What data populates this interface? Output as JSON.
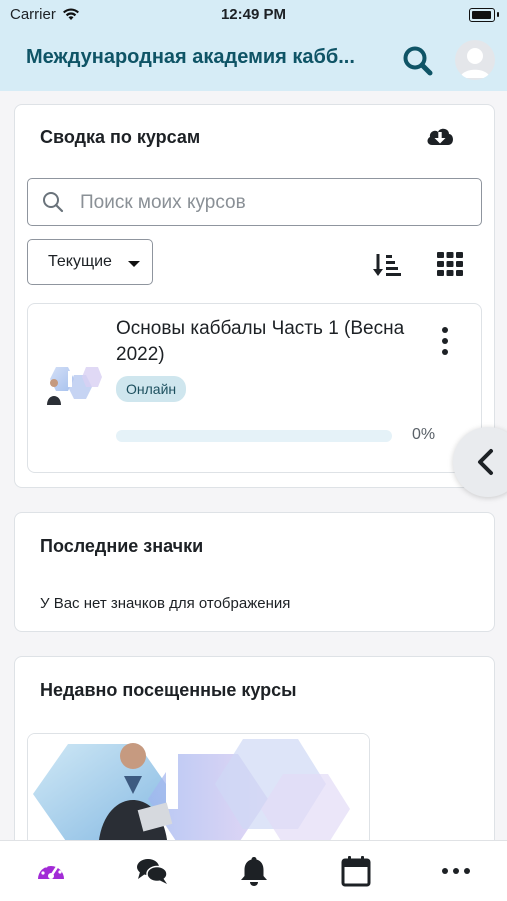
{
  "status_bar": {
    "carrier": "Carrier",
    "time": "12:49 PM"
  },
  "app_bar": {
    "title": "Международная академия кабб..."
  },
  "course_overview": {
    "title": "Сводка по курсам",
    "search_placeholder": "Поиск моих курсов",
    "filter_label": "Текущие",
    "course": {
      "title": "Основы каббалы Часть 1 (Весна 2022)",
      "badge": "Онлайн",
      "progress_label": "0%",
      "progress_value": 0
    }
  },
  "badges_block": {
    "title": "Последние значки",
    "empty_text": "У Вас нет значков для отображения"
  },
  "recent_block": {
    "title": "Недавно посещенные курсы"
  },
  "colors": {
    "header_bg": "#d6ecf6",
    "title_color": "#0f5466",
    "active_nav": "#a22bd6"
  },
  "bottom_nav": [
    {
      "icon": "dashboard-icon"
    },
    {
      "icon": "messages-icon"
    },
    {
      "icon": "notifications-icon"
    },
    {
      "icon": "calendar-icon"
    },
    {
      "icon": "more-icon"
    }
  ]
}
